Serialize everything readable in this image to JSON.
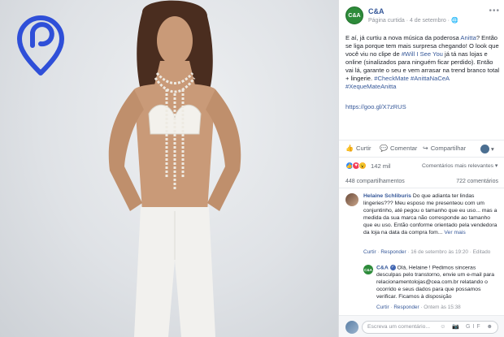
{
  "post": {
    "page_name": "C&A",
    "logo_text": "C&A",
    "meta": "Página curtida · 4 de setembro · 🌐",
    "text_parts": [
      "E aí, já curtiu a nova música da poderosa ",
      "Anitta",
      "? Então se liga porque tem mais surpresa chegando! O look que você viu no clipe de ",
      "#Will I See You",
      " já tá nas lojas e online (sinalizados para ninguém ficar perdido). Então vai lá, garante o seu e vem arrasar na trend branco total + lingerie. ",
      "#CheckMate #AnittaNaCeA #XequeMateAnitta"
    ],
    "link": "https://goo.gl/X7zRUS"
  },
  "actions": {
    "like": "Curtir",
    "comment": "Comentar",
    "share": "Compartilhar"
  },
  "reactions": {
    "count": "142 mil",
    "sort": "Comentários mais relevantes ▾"
  },
  "counts": {
    "shares": "448 compartilhamentos",
    "comments": "722 comentários"
  },
  "comments": [
    {
      "name": "Helaine Schliburis",
      "text": "Do que adianta ter lindas lingeries??? Meu esposo me presenteou com um conjuntinho, até pegou o tamanho que eu uso... mas a medida da sua marca não corresponde ao tamanho que eu uso. Então conforme orientado pela vendedora da loja na data da compra fom...",
      "more": "Ver mais",
      "actions": [
        "Curtir",
        "Responder"
      ],
      "time": "16 de setembro às 19:20 · Editado"
    },
    {
      "name": "C&A",
      "logo_text": "C&A",
      "verified_mark": "✓",
      "text": "Olá, Helaine ! Pedimos sinceras desculpas pelo transtorno, envie um e-mail para relacionamentolojas@cea.com.br relatando o ocorrido e seus dados para que possamos verificar. Ficamos à disposição",
      "actions": [
        "Curtir",
        "Responder"
      ],
      "time": "Ontem às 15:38"
    }
  ],
  "composer": {
    "placeholder": "Escreva um comentário...",
    "icons": "☺ 📷 GIF ☻"
  },
  "colors": {
    "link": "#365899",
    "brand_green": "#2d8b3a",
    "brand_mark_blue": "#2f4fd8"
  }
}
